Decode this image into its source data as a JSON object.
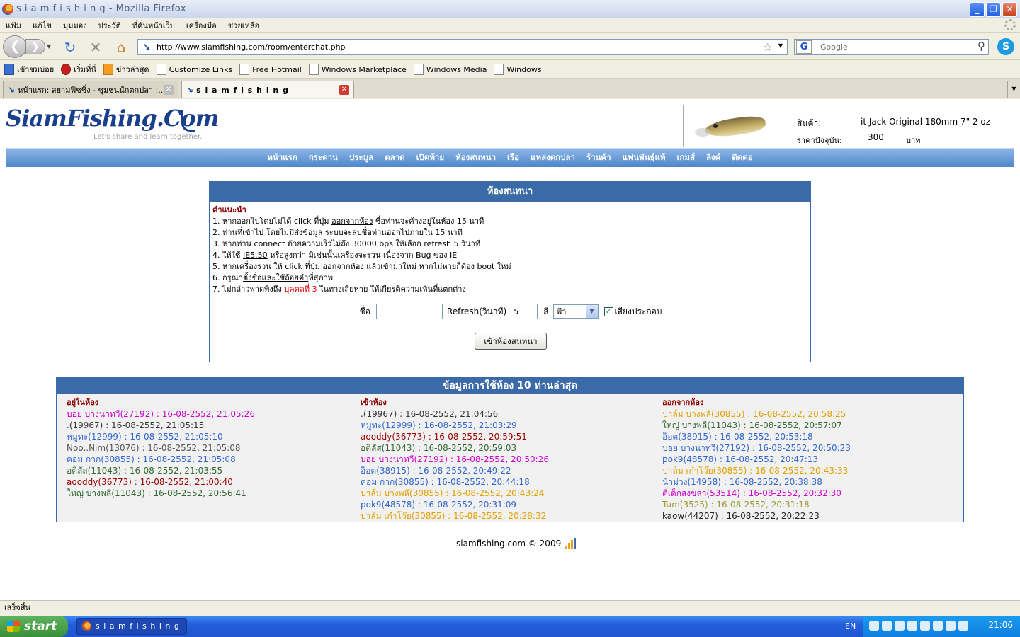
{
  "window": {
    "title": "s i a m f i s h i n g - Mozilla Firefox"
  },
  "menu": [
    "แฟ้ม",
    "แก้ไข",
    "มุมมอง",
    "ประวัติ",
    "ที่คั่นหน้าเว็บ",
    "เครื่องมือ",
    "ช่วยเหลือ"
  ],
  "nav": {
    "url": "http://www.siamfishing.com/room/enterchat.php",
    "search_placeholder": "Google"
  },
  "bookmarks": [
    "เข้าชมบ่อย",
    "เริ่มที่นี่",
    "ข่าวล่าสุด",
    "Customize Links",
    "Free Hotmail",
    "Windows Marketplace",
    "Windows Media",
    "Windows"
  ],
  "tabs": [
    {
      "label": "หน้าแรก: สยามฟิชชิ่ง - ชุมชนนักตกปลา :..."
    },
    {
      "label": "s i a m f i s h i n g"
    }
  ],
  "site": {
    "logo": "SiamFishing.Com",
    "tagline": "Let's share and learn together.",
    "product": {
      "label1": "สินค้า:",
      "value1": "it Jack Original 180mm 7\" 2 oz",
      "label2": "ราคาปัจจุบัน:",
      "value2": "300",
      "unit": "บาท"
    },
    "nav": [
      "หน้าแรก",
      "กระดาน",
      "ประมูล",
      "ตลาด",
      "เปิดท้าย",
      "ห้องสนทนา",
      "เรือ",
      "แหล่งตกปลา",
      "ร้านค้า",
      "แฟนพันธุ์แท้",
      "เกมส์",
      "ลิงค์",
      "ติดต่อ"
    ]
  },
  "chat": {
    "header": "ห้องสนทนา",
    "instr_title": "คำแนะนำ",
    "i1a": "1. หากออกไปโดยไม่ได้ click ที่ปุ่ม ",
    "i1b": "ออกจากห้อง",
    "i1c": " ชื่อท่านจะค้างอยู่ในห้อง 15 นาที",
    "i2": "2. ท่านที่เข้าไป โดยไม่มีส่งข้อมูล ระบบจะลบชื่อท่านออกไปภายใน 15 นาที",
    "i3": "3. หากท่าน connect ด้วยความเร็วไม่ถึง 30000 bps ให้เลือก refresh 5 วินาที",
    "i4a": "4. ให้ใช้ ",
    "i4b": "IE5.50",
    "i4c": " หรือสูงกว่า มิเช่นนั้นเครื่องจะรวน เนื่องจาก Bug ของ IE",
    "i5a": "5. หากเครื่องรวน ให้ click ที่ปุ่ม ",
    "i5b": "ออกจากห้อง",
    "i5c": " แล้วเข้ามาใหม่ หากไม่หายก็ต้อง boot ใหม่",
    "i6a": "6. กรุณา",
    "i6b": "ตั้งชื่อและใช้ถ้อยคำ",
    "i6c": "ที่สุภาพ",
    "i7a": "7. ไม่กล่าวพาดพิงถึง ",
    "i7b": "บุคคลที่ 3",
    "i7c": " ในทางเสียหาย ให้เกียรติความเห็นที่แตกต่าง",
    "name_label": "ชื่อ",
    "refresh_label": "Refresh(วินาที)",
    "refresh_value": "5",
    "color_label": "สี",
    "color_value": "ฟ้า",
    "sound_label": "เสียงประกอบ",
    "enter_button": "เข้าห้องสนทนา"
  },
  "info": {
    "header": "ข้อมูลการใช้ห้อง 10 ท่านล่าสุด",
    "in_room": {
      "title": "อยู่ในห้อง",
      "rows": [
        {
          "name": "บอย บางนาทวี(27192)",
          "time": "16-08-2552, 21:05:26",
          "color": "#cc00cc"
        },
        {
          "name": ".(19967)",
          "time": "16-08-2552, 21:05:15",
          "color": "#333333"
        },
        {
          "name": "หมูทะ(12999)",
          "time": "16-08-2552, 21:05:10",
          "color": "#3366cc"
        },
        {
          "name": "Noo..Nim(13076)",
          "time": "16-08-2552, 21:05:08",
          "color": "#555555"
        },
        {
          "name": "คอม กาก(30855)",
          "time": "16-08-2552, 21:05:08",
          "color": "#3366cc"
        },
        {
          "name": "อติลัส(11043)",
          "time": "16-08-2552, 21:03:55",
          "color": "#336633"
        },
        {
          "name": "aooddy(36773)",
          "time": "16-08-2552, 21:00:40",
          "color": "#990000"
        },
        {
          "name": "ใหญ่ บางพลี(11043)",
          "time": "16-08-2552, 20:56:41",
          "color": "#336633"
        }
      ]
    },
    "entered": {
      "title": "เข้าห้อง",
      "rows": [
        {
          "name": ".(19967)",
          "time": "16-08-2552, 21:04:56",
          "color": "#333333"
        },
        {
          "name": "หมูทะ(12999)",
          "time": "16-08-2552, 21:03:29",
          "color": "#3366cc"
        },
        {
          "name": "aooddy(36773)",
          "time": "16-08-2552, 20:59:51",
          "color": "#990000"
        },
        {
          "name": "อติลัส(11043)",
          "time": "16-08-2552, 20:59:03",
          "color": "#336633"
        },
        {
          "name": "บอย บางนาทวี(27192)",
          "time": "16-08-2552, 20:50:26",
          "color": "#cc00cc"
        },
        {
          "name": "อ็อต(38915)",
          "time": "16-08-2552, 20:49:22",
          "color": "#3366cc"
        },
        {
          "name": "คอม กาก(30855)",
          "time": "16-08-2552, 20:44:18",
          "color": "#3366cc"
        },
        {
          "name": "ปาล์ม บางพลี(30855)",
          "time": "16-08-2552, 20:43:24",
          "color": "#e0a000"
        },
        {
          "name": "pok9(48578)",
          "time": "16-08-2552, 20:31:09",
          "color": "#3366cc"
        },
        {
          "name": "ปาล์ม เก๋าโว๊ย(30855)",
          "time": "16-08-2552, 20:28:32",
          "color": "#e0a000"
        }
      ]
    },
    "left": {
      "title": "ออกจากห้อง",
      "rows": [
        {
          "name": "ปาล์ม บางพลี(30855)",
          "time": "16-08-2552, 20:58:25",
          "color": "#e0a000"
        },
        {
          "name": "ใหญ่ บางพลี(11043)",
          "time": "16-08-2552, 20:57:07",
          "color": "#336633"
        },
        {
          "name": "อ็อต(38915)",
          "time": "16-08-2552, 20:53:18",
          "color": "#3366cc"
        },
        {
          "name": "บอย บางนาทวี(27192)",
          "time": "16-08-2552, 20:50:23",
          "color": "#3366cc"
        },
        {
          "name": "pok9(48578)",
          "time": "16-08-2552, 20:47:13",
          "color": "#3366cc"
        },
        {
          "name": "ปาล์ม เก๋าโว๊ย(30855)",
          "time": "16-08-2552, 20:43:33",
          "color": "#e0a000"
        },
        {
          "name": "น้าม่วง(14958)",
          "time": "16-08-2552, 20:38:38",
          "color": "#3366cc"
        },
        {
          "name": "ตี๋เด็กสงขลา(53514)",
          "time": "16-08-2552, 20:32:30",
          "color": "#cc00cc"
        },
        {
          "name": "Tum(3525)",
          "time": "16-08-2552, 20:31:18",
          "color": "#999933"
        },
        {
          "name": "kaow(44207)",
          "time": "16-08-2552, 20:22:23",
          "color": "#222222"
        }
      ]
    }
  },
  "footer": "siamfishing.com © 2009",
  "status": "เสร็จสิ้น",
  "taskbar": {
    "start": "start",
    "item": "s i a m f i s h i n g - M...",
    "lang": "EN",
    "clock": "21:06"
  }
}
